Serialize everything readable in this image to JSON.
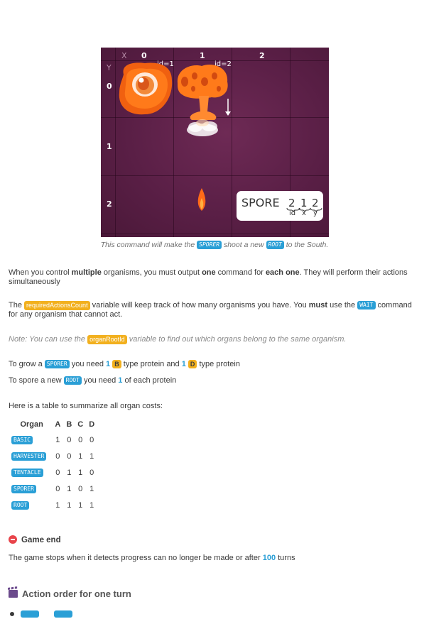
{
  "illustration": {
    "x_axis_label": "X",
    "y_axis_label": "Y",
    "x_ticks": [
      "0",
      "1",
      "2"
    ],
    "y_ticks": [
      "0",
      "1",
      "2"
    ],
    "id_labels": [
      "id=1",
      "id=2"
    ],
    "spore_command": {
      "word": "SPORE",
      "values": [
        "2",
        "1",
        "2"
      ],
      "sub_labels": [
        "id",
        "x",
        "y"
      ]
    }
  },
  "caption": {
    "part1": "This command will make the",
    "tag1": "SPORER",
    "part2": "shoot a new",
    "tag2": "ROOT",
    "part3": "to the South."
  },
  "para_multiple": {
    "t1": "When you control ",
    "b1": "multiple",
    "t2": " organisms, you must output ",
    "b2": "one",
    "t3": " command for ",
    "b3": "each one",
    "t4": ". They will perform their actions simultaneously"
  },
  "para_required": {
    "t1": "The ",
    "tag": "requiredActionsCount",
    "t2": " variable will keep track of how many organisms you have. You ",
    "b1": "must",
    "t3": " use the ",
    "wait": "WAIT",
    "t4": " command for any organism that cannot act."
  },
  "note": {
    "t1": "Note: You can use the ",
    "tag": "organRootId",
    "t2": " variable to find out which organs belong to the same organism."
  },
  "grow_sporer": {
    "t1": "To grow a ",
    "tag": "SPORER",
    "t2": " you need ",
    "n1": "1",
    "l1": "B",
    "t3": " type protein and ",
    "n2": "1",
    "l2": "D",
    "t4": " type protein"
  },
  "spore_root": {
    "t1": "To spore a new ",
    "tag": "ROOT",
    "t2": " you need ",
    "n1": "1",
    "t3": " of each protein"
  },
  "table_intro": "Here is a table to summarize all organ costs:",
  "cost_table": {
    "headers": [
      "Organ",
      "A",
      "B",
      "C",
      "D"
    ],
    "rows": [
      {
        "organ": "BASIC",
        "a": "1",
        "b": "0",
        "c": "0",
        "d": "0"
      },
      {
        "organ": "HARVESTER",
        "a": "0",
        "b": "0",
        "c": "1",
        "d": "1"
      },
      {
        "organ": "TENTACLE",
        "a": "0",
        "b": "1",
        "c": "1",
        "d": "0"
      },
      {
        "organ": "SPORER",
        "a": "0",
        "b": "1",
        "c": "0",
        "d": "1"
      },
      {
        "organ": "ROOT",
        "a": "1",
        "b": "1",
        "c": "1",
        "d": "1"
      }
    ]
  },
  "game_end": {
    "heading": "Game end",
    "t1": "The game stops when it detects progress can no longer be made or after ",
    "n1": "100",
    "t2": " turns"
  },
  "action_order": {
    "heading": "Action order for one turn"
  },
  "colors": {
    "accent_blue": "#2a9fd6",
    "accent_yellow": "#f2b01e",
    "stop_red": "#e8434a",
    "board_bg": "#5a1f46"
  },
  "icons": {
    "game_end": "stop-icon",
    "action_order": "clapperboard-icon"
  }
}
